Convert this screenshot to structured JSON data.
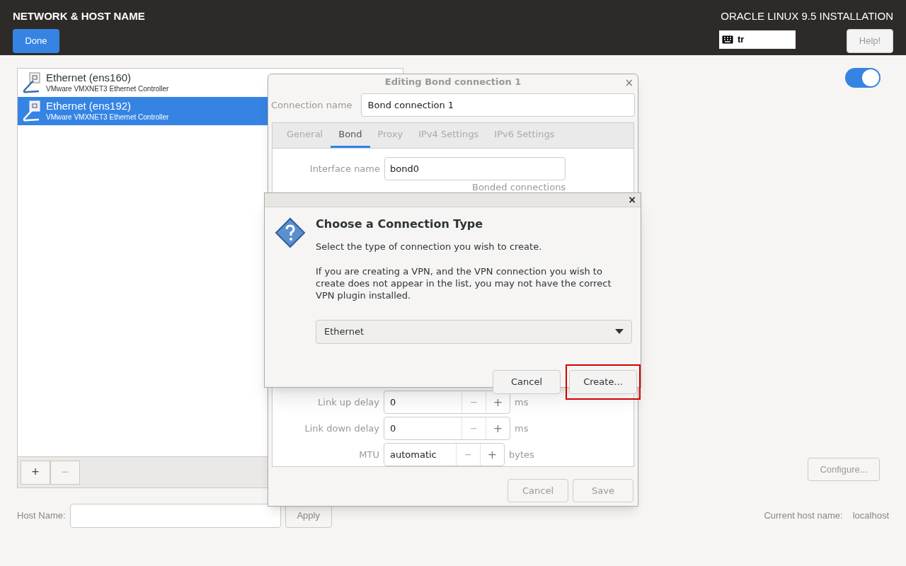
{
  "header": {
    "title": "NETWORK & HOST NAME",
    "done_button": "Done",
    "product": "ORACLE LINUX 9.5 INSTALLATION",
    "keyboard_layout": "tr",
    "help_button": "Help!"
  },
  "devices": [
    {
      "name": "Ethernet (ens160)",
      "description": "VMware VMXNET3 Ethernet Controller",
      "selected": false
    },
    {
      "name": "Ethernet (ens192)",
      "description": "VMware VMXNET3 Ethernet Controller",
      "selected": true
    }
  ],
  "device_toolbar": [
    {
      "label": "+",
      "disabled": false
    },
    {
      "label": "−",
      "disabled": true
    }
  ],
  "network_switch": {
    "on": true
  },
  "configure_button": {
    "label": "Configure...",
    "disabled": true
  },
  "host_name": {
    "label": "Host Name:",
    "apply_button": "Apply"
  },
  "current_host_name": {
    "label": "Current host name:",
    "value": "localhost"
  },
  "editor": {
    "title": "Editing Bond connection 1",
    "close": "×",
    "connection_name_label": "Connection name",
    "connection_name": "Bond connection 1",
    "tabs": [
      {
        "label": "General",
        "selected": false
      },
      {
        "label": "Bond",
        "selected": true
      },
      {
        "label": "Proxy",
        "selected": false
      },
      {
        "label": "IPv4 Settings",
        "selected": false
      },
      {
        "label": "IPv6 Settings",
        "selected": false
      }
    ],
    "interface_name_label": "Interface name",
    "interface_name": "bond0",
    "bonded_connections_label": "Bonded connections",
    "spin_rows": [
      {
        "label": "Link up delay",
        "value": "0",
        "minus": "−",
        "plus": "+",
        "unit": "ms"
      },
      {
        "label": "Link down delay",
        "value": "0",
        "minus": "−",
        "plus": "+",
        "unit": "ms"
      },
      {
        "label": "MTU",
        "value": "automatic",
        "minus": "−",
        "plus": "+",
        "unit": "bytes"
      }
    ],
    "buttons": [
      "Cancel",
      "Save"
    ]
  },
  "dialog": {
    "close": "×",
    "title": "Choose a Connection Type",
    "subtitle": "Select the type of connection you wish to create.",
    "paragraph": "If you are creating a VPN, and the VPN connection you wish to create does not appear in the list, you may not have the correct VPN plugin installed.",
    "connection_type": "Ethernet",
    "buttons": [
      {
        "label": "Cancel",
        "highlighted": false
      },
      {
        "label": "Create...",
        "highlighted": true
      }
    ]
  }
}
